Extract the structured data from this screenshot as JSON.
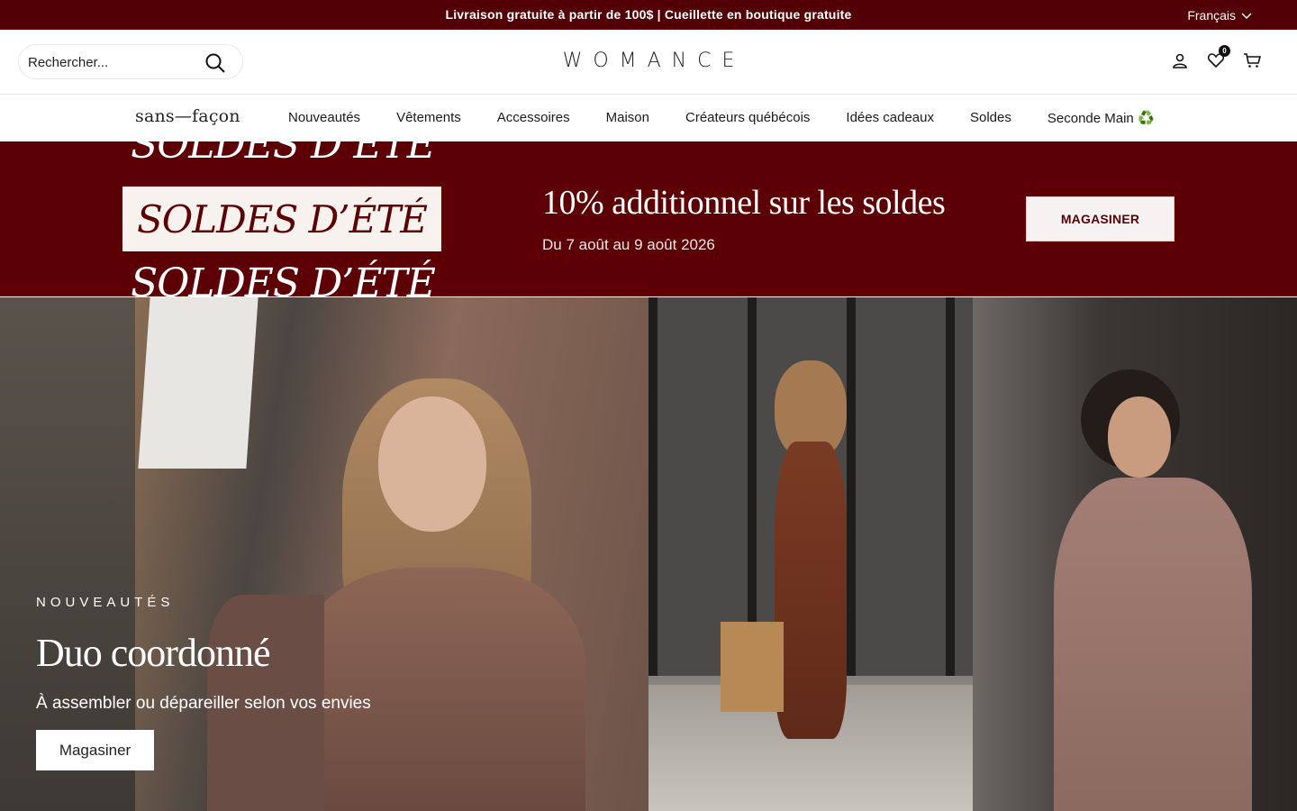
{
  "announcement": {
    "text": "Livraison gratuite à partir de 100$ | Cueillette en boutique gratuite",
    "language": "Français"
  },
  "header": {
    "search_placeholder": "Rechercher...",
    "logo": "WOMANCE",
    "wishlist_count": "0",
    "icons": [
      "search-icon",
      "account-icon",
      "heart-icon",
      "cart-icon"
    ]
  },
  "nav": {
    "brand": "sans—façon",
    "items": [
      "Nouveautés",
      "Vêtements",
      "Accessoires",
      "Maison",
      "Créateurs québécois",
      "Idées cadeaux",
      "Soldes",
      "Seconde Main ♻️"
    ]
  },
  "promo": {
    "soldes_label": "SOLDES D’ÉTÉ",
    "title": "10% additionnel sur les soldes",
    "dates": "Du 7 août au 9 août 2026",
    "button": "MAGASINER"
  },
  "hero": {
    "eyebrow": "NOUVEAUTÉS",
    "title": "Duo coordonné",
    "subtitle": "À assembler ou dépareiller selon vos envies",
    "button": "Magasiner"
  },
  "colors": {
    "announcement_bg": "#520005",
    "promo_bg": "#5c0005",
    "promo_button_text": "#5c0005"
  }
}
